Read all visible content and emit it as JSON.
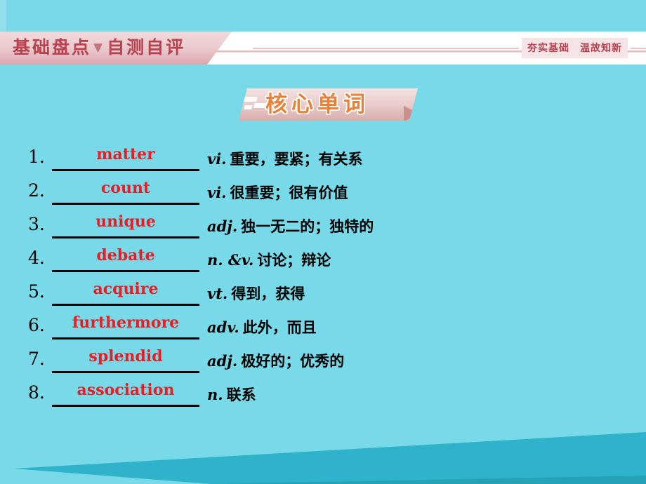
{
  "header": {
    "title_left": "基础盘点",
    "title_caret": "▼",
    "title_right": "自测自评",
    "subtitle": "夯实基础　温故知新"
  },
  "section": {
    "title": "核心单词"
  },
  "words": [
    {
      "num": "1.",
      "word": "matter",
      "pos": "vi.",
      "meaning": "重要，要紧；有关系"
    },
    {
      "num": "2.",
      "word": "count",
      "pos": "vi.",
      "meaning": "很重要；很有价值"
    },
    {
      "num": "3.",
      "word": "unique",
      "pos": "adj.",
      "meaning": "独一无二的；独特的"
    },
    {
      "num": "4.",
      "word": "debate",
      "pos": "n. &v.",
      "meaning": "讨论；辩论"
    },
    {
      "num": "5.",
      "word": "acquire",
      "pos": "vt.",
      "meaning": "得到，获得"
    },
    {
      "num": "6.",
      "word": "furthermore",
      "pos": "adv.",
      "meaning": "此外，而且"
    },
    {
      "num": "7.",
      "word": "splendid",
      "pos": "adj.",
      "meaning": "极好的；优秀的"
    },
    {
      "num": "8.",
      "word": "association",
      "pos": "n.",
      "meaning": "联系"
    }
  ],
  "colors": {
    "background": "#78d9e8",
    "wedge": "#2fb3ca",
    "word_red": "#ec1c24",
    "title_orange": "#e8813a",
    "header_pink": "#b9414f"
  }
}
